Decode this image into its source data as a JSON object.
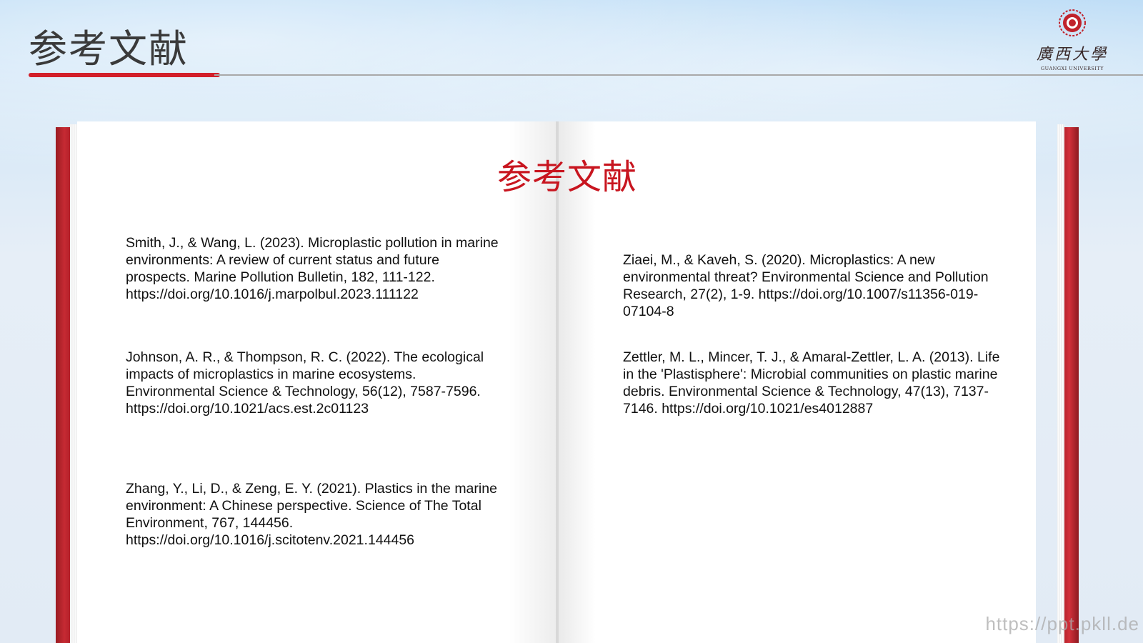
{
  "header": {
    "title": "参考文献",
    "accent_color": "#d21f2a"
  },
  "logo": {
    "name": "廣西大學",
    "subtitle": "GUANGXI UNIVERSITY"
  },
  "book": {
    "heading": "参考文献",
    "heading_color": "#c8151f",
    "references_left": [
      "Smith, J., & Wang, L. (2023). Microplastic pollution in marine environments: A review of current status and future prospects. Marine Pollution Bulletin, 182, 111-122. https://doi.org/10.1016/j.marpolbul.2023.111122",
      "Johnson, A. R., & Thompson, R. C. (2022). The ecological impacts of microplastics in marine ecosystems. Environmental Science & Technology, 56(12), 7587-7596. https://doi.org/10.1021/acs.est.2c01123",
      "Zhang, Y., Li, D., & Zeng, E. Y. (2021). Plastics in the marine environment: A Chinese perspective. Science of The Total Environment, 767, 144456. https://doi.org/10.1016/j.scitotenv.2021.144456"
    ],
    "references_right": [
      "Ziaei, M., & Kaveh, S. (2020). Microplastics: A new environmental threat? Environmental Science and Pollution Research, 27(2), 1-9. https://doi.org/10.1007/s11356-019-07104-8",
      "Zettler, M. L., Mincer, T. J., & Amaral-Zettler, L. A. (2013). Life in the 'Plastisphere': Microbial communities on plastic marine debris. Environmental Science & Technology, 47(13), 7137-7146. https://doi.org/10.1021/es4012887"
    ]
  },
  "watermark": "https://ppt.pkll.de"
}
